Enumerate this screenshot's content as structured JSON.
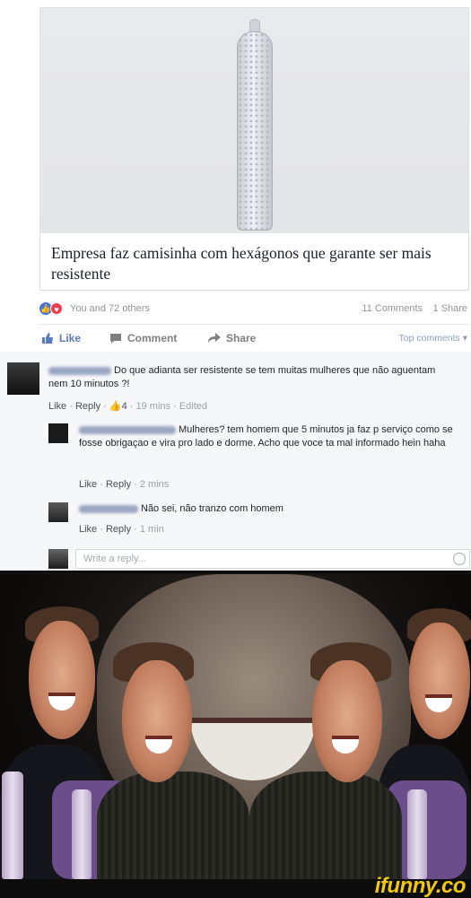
{
  "link_preview": {
    "title": "Empresa faz camisinha com hexágonos que garante ser mais resistente"
  },
  "reactions": {
    "summary": "You and 72 others",
    "comments": "11 Comments",
    "shares": "1 Share"
  },
  "actions": {
    "like": "Like",
    "comment": "Comment",
    "share": "Share",
    "sort": "Top comments ▾"
  },
  "comments": [
    {
      "text": "Do que adianta ser resistente se tem muitas mulheres que não aguentam nem 10 minutos ?!",
      "like": "Like",
      "reply": "Reply",
      "likes_count": "4",
      "time": "19 mins",
      "edited": "Edited"
    },
    {
      "text": "Mulheres? tem homem que 5 minutos ja faz p serviço como se fosse obrigaçao e vira pro lado e dorme. Acho que voce ta mal informado hein haha",
      "like": "Like",
      "reply": "Reply",
      "time": "2 mins"
    },
    {
      "text": "Não sei, não tranzo com homem",
      "like": "Like",
      "reply": "Reply",
      "time": "1 min"
    }
  ],
  "reply_box": {
    "placeholder": "Write a reply..."
  },
  "watermark": "ifunny.co",
  "colors": {
    "facebook_blue": "#4a76d6",
    "love_red": "#ef3d4d",
    "ifunny_yellow": "#f2c80c"
  }
}
